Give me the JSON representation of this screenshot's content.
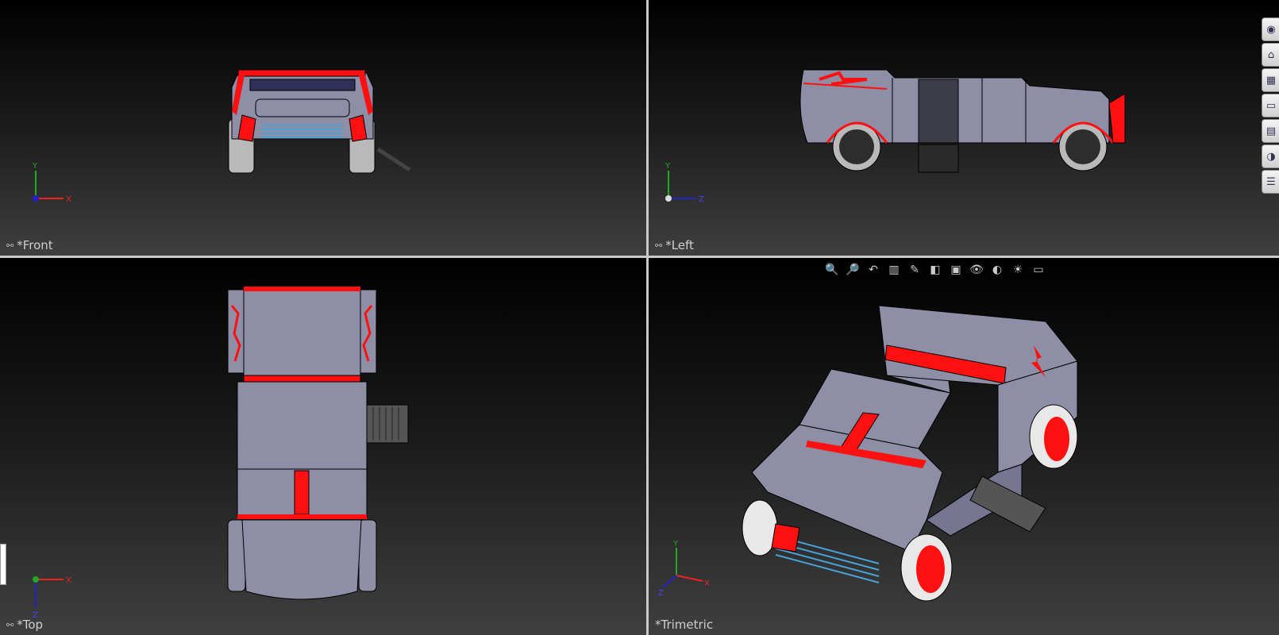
{
  "viewports": {
    "front": {
      "label": "*Front",
      "triad": {
        "up": "Y",
        "right": "X"
      }
    },
    "left": {
      "label": "*Left",
      "triad": {
        "up": "Y",
        "right": "Z"
      }
    },
    "top": {
      "label": "*Top",
      "triad": {
        "down": "Z",
        "right": "X"
      }
    },
    "trimetric": {
      "label": "*Trimetric",
      "triad": {
        "up": "Y",
        "right": "X",
        "left": "Z"
      }
    }
  },
  "heads_up_toolbar": [
    {
      "icon": "zoom-to-fit-icon",
      "glyph": "🔍"
    },
    {
      "icon": "zoom-to-area-icon",
      "glyph": "🔎"
    },
    {
      "icon": "previous-view-icon",
      "glyph": "↶"
    },
    {
      "icon": "section-view-icon",
      "glyph": "▥"
    },
    {
      "icon": "dynamic-annotation-icon",
      "glyph": "✎"
    },
    {
      "icon": "view-orientation-icon",
      "glyph": "◧"
    },
    {
      "icon": "display-style-icon",
      "glyph": "▣"
    },
    {
      "icon": "hide-show-items-icon",
      "glyph": "👁"
    },
    {
      "icon": "edit-appearance-icon",
      "glyph": "◐"
    },
    {
      "icon": "apply-scene-icon",
      "glyph": "☀"
    },
    {
      "icon": "view-settings-icon",
      "glyph": "▭"
    }
  ],
  "task_pane": [
    {
      "icon": "solidworks-resources-icon",
      "glyph": "◉"
    },
    {
      "icon": "home-icon",
      "glyph": "⌂"
    },
    {
      "icon": "design-library-icon",
      "glyph": "▦"
    },
    {
      "icon": "file-explorer-icon",
      "glyph": "▭"
    },
    {
      "icon": "view-palette-icon",
      "glyph": "▤"
    },
    {
      "icon": "appearances-scenes-icon",
      "glyph": "◑"
    },
    {
      "icon": "custom-properties-icon",
      "glyph": "☰"
    }
  ],
  "colors": {
    "body": "#8e8ea6",
    "accent": "#ff1010",
    "edge": "#000000",
    "highlight": "#4aa3d8",
    "tire": "#b8b8b8"
  }
}
